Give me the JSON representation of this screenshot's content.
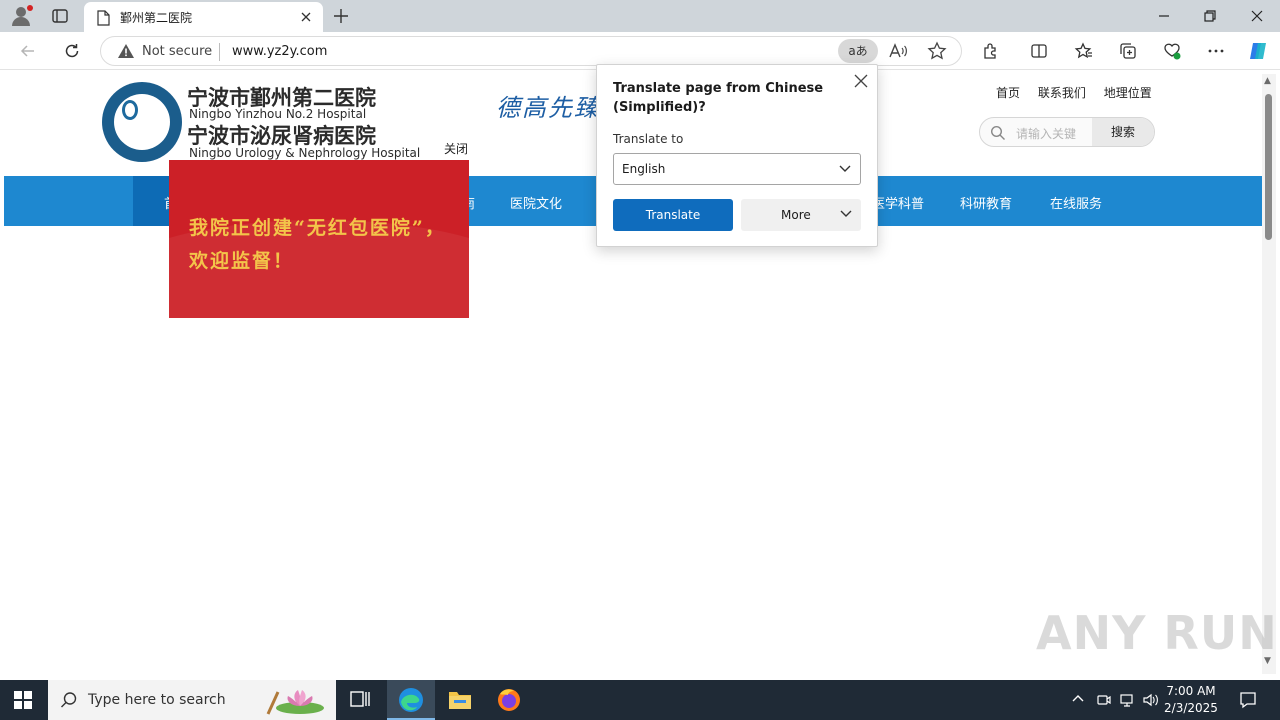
{
  "browser": {
    "tab_title": "鄞州第二医院",
    "security_label": "Not secure",
    "url": "www.yz2y.com",
    "translate_pill": "aあ",
    "read_aloud": "A",
    "accent_color": "#0f6cbd"
  },
  "site": {
    "name_cn_1": "宁波市鄞州第二医院",
    "name_en_1": "Ningbo Yinzhou No.2 Hospital",
    "name_cn_2": "宁波市泌尿肾病医院",
    "name_en_2": "Ningbo Urology & Nephrology Hospital",
    "slogan": "德高先臻",
    "close_link": "关闭",
    "top_links": [
      "首页",
      "联系我们",
      "地理位置"
    ],
    "search_placeholder": "请输入关键",
    "search_button": "搜索",
    "nav_items": [
      "首",
      "南",
      "医院文化",
      "医学科普",
      "科研教育",
      "在线服务"
    ],
    "nav_color": "#1e88d0",
    "ad_text": "我院正创建“无红包医院”，欢迎监督！",
    "ad_color": "#cc2027"
  },
  "translate_flyout": {
    "heading": "Translate page from Chinese (Simplified)?",
    "translate_to_label": "Translate to",
    "selected_language": "English",
    "translate_button": "Translate",
    "more_button": "More"
  },
  "watermark": "ANY RUN",
  "taskbar": {
    "search_text": "Type here to search",
    "time": "7:00 AM",
    "date": "2/3/2025"
  }
}
